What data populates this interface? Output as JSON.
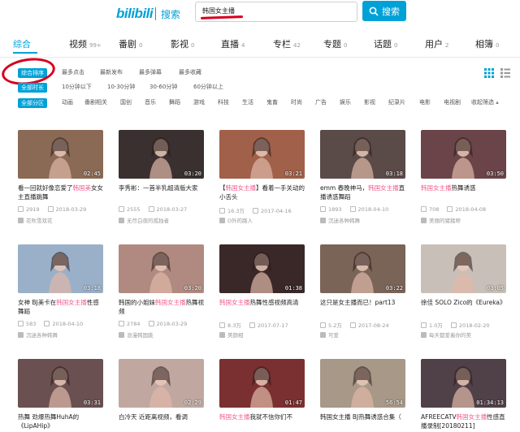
{
  "header": {
    "logo": "bilibili",
    "logo_sub": "搜索",
    "search_value": "韩国女主播",
    "search_button": "搜索"
  },
  "tabs": [
    {
      "label": "综合",
      "count": ""
    },
    {
      "label": "视频",
      "count": "99+"
    },
    {
      "label": "番剧",
      "count": "0"
    },
    {
      "label": "影视",
      "count": "0"
    },
    {
      "label": "直播",
      "count": "4"
    },
    {
      "label": "专栏",
      "count": "42"
    },
    {
      "label": "专题",
      "count": "0"
    },
    {
      "label": "话题",
      "count": "0"
    },
    {
      "label": "用户",
      "count": "2"
    },
    {
      "label": "相簿",
      "count": "0"
    }
  ],
  "sort_options": [
    "综合排序",
    "最多点击",
    "最新发布",
    "最多弹幕",
    "最多收藏"
  ],
  "duration_filter": {
    "label": "全部时长",
    "options": [
      "10分钟以下",
      "10-30分钟",
      "30-60分钟",
      "60分钟以上"
    ]
  },
  "zone_filter": {
    "label": "全部分区",
    "options": [
      "动画",
      "番剧相关",
      "国创",
      "音乐",
      "舞蹈",
      "游戏",
      "科技",
      "生活",
      "鬼畜",
      "时尚",
      "广告",
      "娱乐",
      "影视",
      "纪录片",
      "电影",
      "电视剧",
      "收起筛选"
    ]
  },
  "videos": [
    {
      "duration": "02:45",
      "title_pre": "看一回就好像恋爱了",
      "title_hl": "韩国美",
      "title_post": "女女主直播跳舞",
      "views": "2919",
      "date": "2018-03-29",
      "up": "花吹雪双花",
      "bg": "#8b6a55"
    },
    {
      "duration": "03:20",
      "title_pre": "李秀彬：一首半乳超清版",
      "title_hl": "",
      "title_post": "大家",
      "views": "2555",
      "date": "2018-03-27",
      "up": "无尽白夜的孤独者",
      "bg": "#3a3030"
    },
    {
      "duration": "03:21",
      "title_pre": "【",
      "title_hl": "韩国女主播",
      "title_post": "】看着一手关动的小舌头",
      "views": "16.3万",
      "date": "2017-04-16",
      "up": "D外的路人",
      "bg": "#a0604a"
    },
    {
      "duration": "03:18",
      "title_pre": "emm 春晚神马，",
      "title_hl": "韩国女主播",
      "title_post": "直播诱惑舞蹈",
      "views": "1893",
      "date": "2018-04-10",
      "up": "沉迷各种韩舞",
      "bg": "#5a4a48"
    },
    {
      "duration": "03:50",
      "title_pre": "",
      "title_hl": "韩国女主播",
      "title_post": "热舞诱惑",
      "views": "708",
      "date": "2018-04-08",
      "up": "美丽的猪猪帮",
      "bg": "#6a4448"
    },
    {
      "duration": "03:18",
      "title_pre": "女神 BJ美卡在",
      "title_hl": "韩国女主播",
      "title_post": "性感舞蹈",
      "views": "583",
      "date": "2018-04-10",
      "up": "沉迷各种韩舞",
      "bg": "#9ab0c8"
    },
    {
      "duration": "03:20",
      "title_pre": "韩国的小姐妹",
      "title_hl": "韩国女主播",
      "title_post": "热舞视频",
      "views": "2784",
      "date": "2018-03-29",
      "up": "浪漫韩国跳",
      "bg": "#b08a80"
    },
    {
      "duration": "01:38",
      "title_pre": "",
      "title_hl": "韩国女主播",
      "title_post": "热舞性感视频高清",
      "views": "8.3万",
      "date": "2017-07-17",
      "up": "美颜相",
      "bg": "#3a2828"
    },
    {
      "duration": "03:22",
      "title_pre": "这只是女主播而已！part13",
      "title_hl": "",
      "title_post": "",
      "views": "5.2万",
      "date": "2017-08-24",
      "up": "可爱",
      "bg": "#7a6458"
    },
    {
      "duration": "03:05",
      "title_pre": "徐佳 SOLO Zico的《Eureka》",
      "title_hl": "",
      "title_post": "",
      "views": "1.0万",
      "date": "2018-02-20",
      "up": "每天都爱着你的美",
      "bg": "#c8c0b8"
    },
    {
      "duration": "03:31",
      "title_pre": "热舞 劲爆热舞HuhA的《LipAHip》",
      "title_hl": "",
      "title_post": "",
      "views": "",
      "date": "",
      "up": "",
      "bg": "#6a5050"
    },
    {
      "duration": "02:29",
      "title_pre": "白冷天 近距离视频，看调",
      "title_hl": "",
      "title_post": "",
      "views": "",
      "date": "",
      "up": "",
      "bg": "#c0a8a0"
    },
    {
      "duration": "01:47",
      "title_pre": "",
      "title_hl": "韩国女主播",
      "title_post": "我就不信你们不",
      "views": "",
      "date": "",
      "up": "",
      "bg": "#7a3030"
    },
    {
      "duration": "56:54",
      "title_pre": "韩国女主播 BJ热舞诱惑合集（",
      "title_hl": "",
      "title_post": "",
      "views": "",
      "date": "",
      "up": "",
      "bg": "#a89888"
    },
    {
      "duration": "01:34:13",
      "title_pre": "AFREECATV",
      "title_hl": "韩国女主播",
      "title_post": "性感直播录制[20180211]",
      "views": "",
      "date": "",
      "up": "",
      "bg": "#504048"
    }
  ],
  "colors": {
    "accent": "#00a1d6",
    "highlight": "#f25d8e",
    "annotation": "#d6001c"
  }
}
